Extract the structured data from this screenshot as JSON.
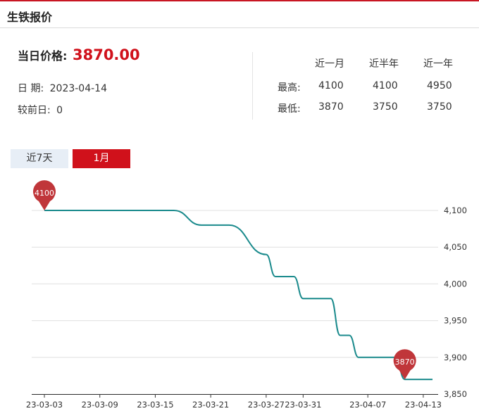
{
  "header": {
    "title": "生铁报价"
  },
  "summary": {
    "price_label": "当日价格:",
    "price_value": "3870.00",
    "date_label": "日 期:",
    "date_value": "2023-04-14",
    "change_label": "较前日:",
    "change_value": "0"
  },
  "stats": {
    "columns": [
      "近一月",
      "近半年",
      "近一年"
    ],
    "rows": [
      {
        "label": "最高:",
        "values": [
          "4100",
          "4100",
          "4950"
        ]
      },
      {
        "label": "最低:",
        "values": [
          "3870",
          "3750",
          "3750"
        ]
      }
    ]
  },
  "tabs": [
    {
      "label": "近7天",
      "active": false
    },
    {
      "label": "1月",
      "active": true
    }
  ],
  "colors": {
    "accent": "#d0111b",
    "line": "#1a8a8c",
    "marker": "#c0363a"
  },
  "chart_data": {
    "type": "line",
    "title": "",
    "xlabel": "",
    "ylabel": "",
    "ylim": [
      3850,
      4100
    ],
    "x_ticks": [
      "23-03-03",
      "23-03-09",
      "23-03-15",
      "23-03-21",
      "23-03-27",
      "23-03-31",
      "23-04-07",
      "23-04-13"
    ],
    "y_ticks": [
      3850,
      3900,
      3950,
      4000,
      4050,
      4100
    ],
    "grid": true,
    "points": [
      [
        "23-03-03",
        4100
      ],
      [
        "23-03-17",
        4100
      ],
      [
        "23-03-20",
        4080
      ],
      [
        "23-03-23",
        4080
      ],
      [
        "23-03-27",
        4040
      ],
      [
        "23-03-28",
        4010
      ],
      [
        "23-03-30",
        4010
      ],
      [
        "23-03-31",
        3980
      ],
      [
        "23-04-03",
        3980
      ],
      [
        "23-04-04",
        3930
      ],
      [
        "23-04-05",
        3930
      ],
      [
        "23-04-06",
        3900
      ],
      [
        "23-04-10",
        3900
      ],
      [
        "23-04-11",
        3870
      ],
      [
        "23-04-14",
        3870
      ]
    ],
    "annotations": [
      {
        "label": "4100",
        "x": "23-03-03",
        "y": 4100
      },
      {
        "label": "3870",
        "x": "23-04-11",
        "y": 3870
      }
    ]
  }
}
